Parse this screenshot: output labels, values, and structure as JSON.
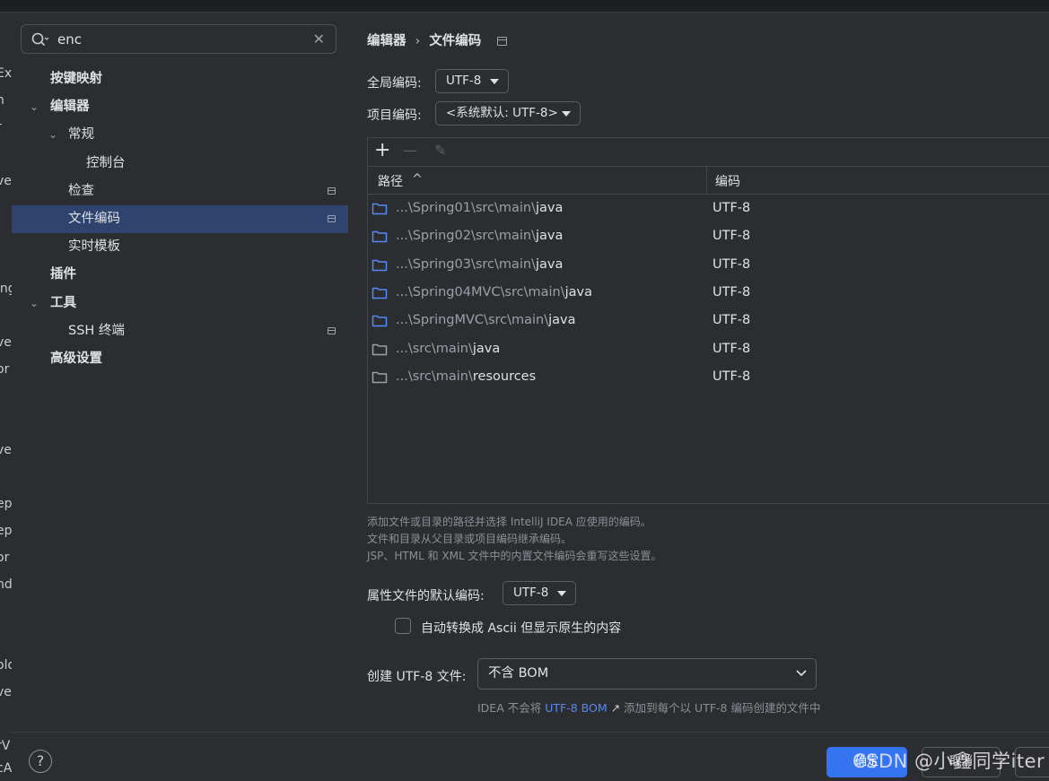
{
  "left_edge_fragments": [
    "Ex",
    "n",
    "r",
    "ve",
    "ing",
    "ve",
    "or",
    "ve",
    "ep",
    "ep",
    "or",
    "nd",
    "olo",
    "ve",
    "rV",
    "cA"
  ],
  "search": {
    "value": "enc"
  },
  "tree": [
    {
      "label": "按键映射",
      "bold": true,
      "arrow": "",
      "pinned": false,
      "selected": false
    },
    {
      "label": "编辑器",
      "bold": true,
      "arrow": "⌄",
      "pinned": false,
      "selected": false
    },
    {
      "label": "常规",
      "bold": false,
      "arrow": "⌄",
      "pinned": false,
      "selected": false
    },
    {
      "label": "控制台",
      "bold": false,
      "arrow": "",
      "pinned": false,
      "selected": false
    },
    {
      "label": "检查",
      "bold": false,
      "arrow": "",
      "pinned": true,
      "selected": false
    },
    {
      "label": "文件编码",
      "bold": false,
      "arrow": "",
      "pinned": true,
      "selected": true
    },
    {
      "label": "实时模板",
      "bold": false,
      "arrow": "",
      "pinned": false,
      "selected": false
    },
    {
      "label": "插件",
      "bold": true,
      "arrow": "",
      "pinned": false,
      "selected": false
    },
    {
      "label": "工具",
      "bold": true,
      "arrow": "⌄",
      "pinned": false,
      "selected": false
    },
    {
      "label": "SSH 终端",
      "bold": false,
      "arrow": "",
      "pinned": true,
      "selected": false
    },
    {
      "label": "高级设置",
      "bold": true,
      "arrow": "",
      "pinned": false,
      "selected": false
    }
  ],
  "breadcrumb": {
    "parent": "编辑器",
    "separator": "›",
    "current": "文件编码"
  },
  "global_encoding": {
    "label": "全局编码:",
    "value": "UTF-8"
  },
  "project_encoding": {
    "label": "项目编码:",
    "value": "<系统默认: UTF-8>"
  },
  "toolbar": {
    "add": "+",
    "remove": "—",
    "edit": "✎"
  },
  "table": {
    "headers": {
      "path": "路径",
      "sort": "^",
      "encoding": "编码"
    },
    "rows": [
      {
        "dim": "...\\Spring01\\src\\main\\",
        "hi": "java",
        "encoding": "UTF-8",
        "folder": "blue"
      },
      {
        "dim": "...\\Spring02\\src\\main\\",
        "hi": "java",
        "encoding": "UTF-8",
        "folder": "blue"
      },
      {
        "dim": "...\\Spring03\\src\\main\\",
        "hi": "java",
        "encoding": "UTF-8",
        "folder": "blue"
      },
      {
        "dim": "...\\Spring04MVC\\src\\main\\",
        "hi": "java",
        "encoding": "UTF-8",
        "folder": "blue"
      },
      {
        "dim": "...\\SpringMVC\\src\\main\\",
        "hi": "java",
        "encoding": "UTF-8",
        "folder": "blue"
      },
      {
        "dim": "...\\src\\main\\",
        "hi": "java",
        "encoding": "UTF-8",
        "folder": "gray"
      },
      {
        "dim": "...\\src\\main\\",
        "hi": "resources",
        "encoding": "UTF-8",
        "folder": "gray"
      }
    ]
  },
  "hints": [
    "添加文件或目录的路径并选择 IntelliJ IDEA 应使用的编码。",
    "文件和目录从父目录或项目编码继承编码。",
    "JSP、HTML 和 XML 文件中的内置文件编码会重写这些设置。"
  ],
  "properties_encoding": {
    "label": "属性文件的默认编码:",
    "value": "UTF-8"
  },
  "ascii_checkbox": {
    "label": "自动转换成 Ascii 但显示原生的内容",
    "checked": false
  },
  "bom": {
    "label": "创建 UTF-8 文件:",
    "value": "不含 BOM",
    "note_prefix": "IDEA 不会将",
    "note_link": "UTF-8 BOM",
    "note_arrow": "↗",
    "note_suffix": "添加到每个以 UTF-8 编码创建的文件中"
  },
  "footer": {
    "help": "?",
    "ok": "确定",
    "cancel": "取消"
  },
  "watermark": "CSDN @小鑫同学iter",
  "colors": {
    "accent": "#3574f0",
    "selection": "#2e436e",
    "link": "#548af7",
    "folder_blue": "#548af7",
    "folder_gray": "#9da0a8"
  }
}
